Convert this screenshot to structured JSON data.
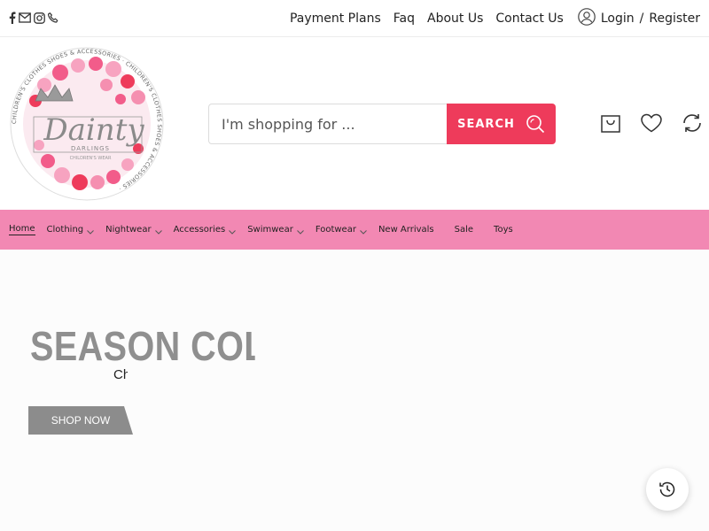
{
  "topbar": {
    "social_icons": [
      "facebook-icon",
      "email-icon",
      "instagram-icon",
      "phone-icon"
    ],
    "links": [
      "Payment Plans",
      "Faq",
      "About Us",
      "Contact Us"
    ],
    "login": "Login",
    "separator": "/",
    "register": "Register"
  },
  "logo": {
    "brand": "Dainty",
    "line2": "DARLINGS",
    "line3": "CHILDREN'S WEAR",
    "ring_text": "CHILDREN'S CLOTHES SHOES & ACCESSORIES · CHILDREN'S CLOTHES SHOES & ACCESSORIES ·"
  },
  "search": {
    "placeholder": "I'm shopping for ...",
    "button_label": "SEARCH"
  },
  "header_icons": [
    "shopping-bag-icon",
    "heart-icon",
    "compare-icon"
  ],
  "nav": {
    "items": [
      {
        "label": "Home",
        "dropdown": false,
        "active": true
      },
      {
        "label": "Clothing",
        "dropdown": true
      },
      {
        "label": "Nightwear",
        "dropdown": true
      },
      {
        "label": "Accessories",
        "dropdown": true
      },
      {
        "label": "Swimwear",
        "dropdown": true
      },
      {
        "label": "Footwear",
        "dropdown": true
      },
      {
        "label": "New Arrivals",
        "dropdown": false
      },
      {
        "label": "Sale",
        "dropdown": false
      },
      {
        "label": "Toys",
        "dropdown": false
      }
    ]
  },
  "hero": {
    "title": "SEASON COLLECTION",
    "subtitle": "Children's Wear",
    "button": "SHOP NOW"
  },
  "colors": {
    "accent": "#ee3b5b",
    "nav_bg": "#f288b3",
    "hero_title": "#8f8f8f",
    "hero_button": "#8c8c8c"
  }
}
